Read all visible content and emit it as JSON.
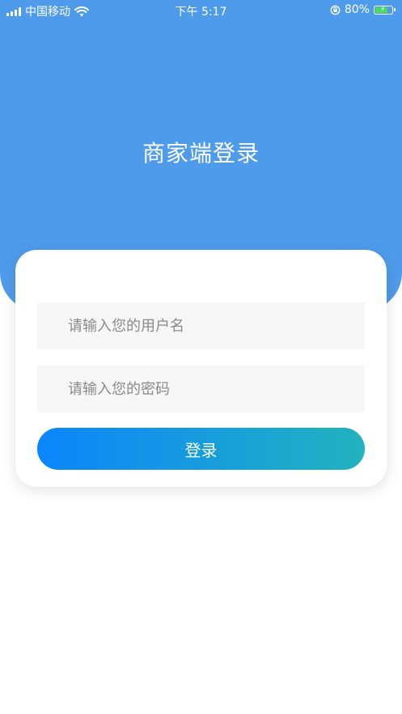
{
  "status_bar": {
    "carrier": "中国移动",
    "time": "下午 5:17",
    "battery_percent": "80%",
    "battery_level": 0.8,
    "icons": [
      "signal-icon",
      "wifi-icon",
      "orientation-lock-icon",
      "battery-icon",
      "charging-icon"
    ]
  },
  "header": {
    "title": "商家端登录"
  },
  "login_form": {
    "username_placeholder": "请输入您的用户名",
    "username_value": "",
    "password_placeholder": "请输入您的密码",
    "password_value": "",
    "submit_label": "登录"
  },
  "colors": {
    "hero_background": "#4f9beb",
    "button_gradient_start": "#0a86fb",
    "button_gradient_end": "#22b2bf",
    "input_background": "#f6f6f6"
  }
}
